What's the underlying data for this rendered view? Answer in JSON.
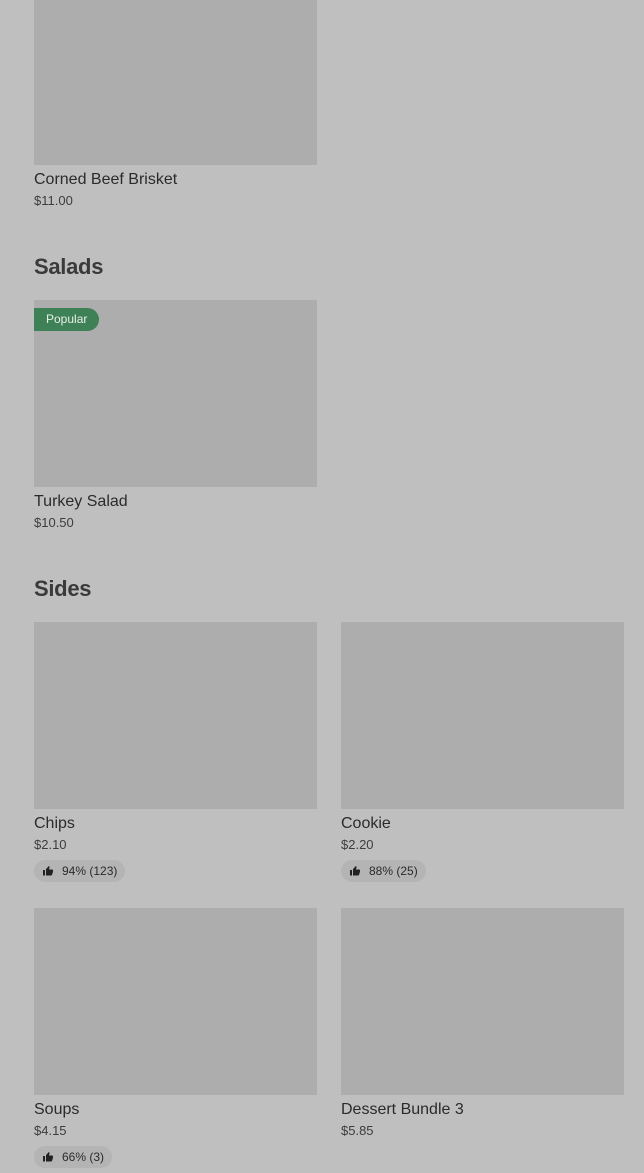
{
  "colors": {
    "background": "#bfbfbf",
    "image_placeholder": "#adadad",
    "popular_badge": "#3f8156",
    "rating_badge": "#b4b4b4"
  },
  "sections": {
    "salads": {
      "title": "Salads"
    },
    "sides": {
      "title": "Sides"
    }
  },
  "items": {
    "corned_beef": {
      "name": "Corned Beef Brisket",
      "price": "$11.00"
    },
    "turkey_salad": {
      "name": "Turkey Salad",
      "price": "$10.50",
      "badge": "Popular"
    },
    "chips": {
      "name": "Chips",
      "price": "$2.10",
      "rating": "94% (123)",
      "rating_icon": "thumbs-up-icon"
    },
    "cookie": {
      "name": "Cookie",
      "price": "$2.20",
      "rating": "88% (25)",
      "rating_icon": "thumbs-up-icon"
    },
    "soups": {
      "name": "Soups",
      "price": "$4.15",
      "rating": "66% (3)",
      "rating_icon": "thumbs-up-icon"
    },
    "dessert_bundle": {
      "name": "Dessert Bundle 3",
      "price": "$5.85"
    }
  }
}
